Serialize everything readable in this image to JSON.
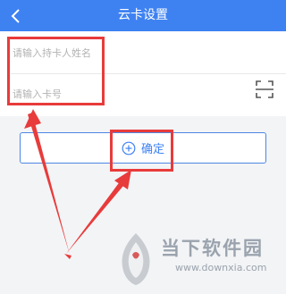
{
  "header": {
    "title": "云卡设置",
    "back_icon": "chevron-left-icon",
    "bg_color": "#3e82f2"
  },
  "form": {
    "name_placeholder": "请输入持卡人姓名",
    "card_placeholder": "请输入卡号",
    "scan_icon": "scan-frame-icon"
  },
  "confirm_button": {
    "label": "确定",
    "icon": "plus-circle-icon",
    "color": "#3e82f2"
  },
  "annotation": {
    "color": "#e83b3b"
  },
  "watermark": {
    "name": "当下软件园",
    "url": "www.downxia.com"
  }
}
